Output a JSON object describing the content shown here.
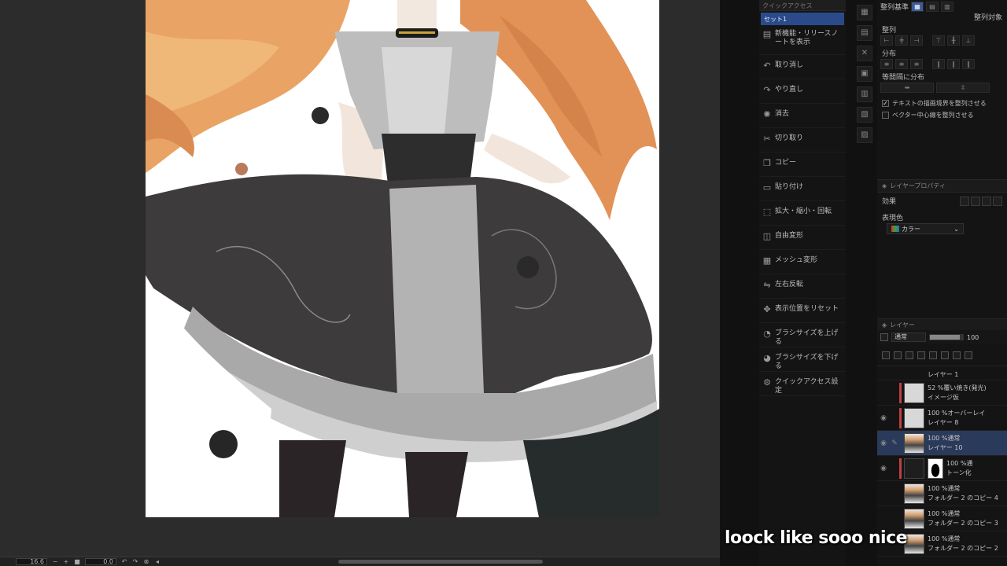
{
  "status_bar": {
    "zoom": "16.6",
    "rotation": "0.0"
  },
  "quick_menu": {
    "header": "クイックアクセス",
    "tab": "セット1",
    "items": [
      {
        "icon": "notes-icon",
        "label": "新機能・リリースノートを表示"
      },
      {
        "icon": "undo-icon",
        "label": "取り消し"
      },
      {
        "icon": "redo-icon",
        "label": "やり直し"
      },
      {
        "icon": "erase-icon",
        "label": "消去"
      },
      {
        "icon": "scissors-icon",
        "label": "切り取り"
      },
      {
        "icon": "copy-icon",
        "label": "コピー"
      },
      {
        "icon": "paste-icon",
        "label": "貼り付け"
      },
      {
        "icon": "transform-icon",
        "label": "拡大・縮小・回転"
      },
      {
        "icon": "free-transform-icon",
        "label": "自由変形"
      },
      {
        "icon": "mesh-icon",
        "label": "メッシュ変形"
      },
      {
        "icon": "flip-icon",
        "label": "左右反転"
      },
      {
        "icon": "reset-view-icon",
        "label": "表示位置をリセット"
      },
      {
        "icon": "brush-up-icon",
        "label": "ブラシサイズを上げる"
      },
      {
        "icon": "brush-down-icon",
        "label": "ブラシサイズを下げる"
      },
      {
        "icon": "settings-icon",
        "label": "クイックアクセス設定"
      }
    ]
  },
  "align_panel": {
    "reference_label": "整列基準",
    "target_label": "整列対象",
    "align_label": "整列",
    "distribute_label": "分布",
    "spacing_label": "等間隔に分布",
    "check_text_bounds": "テキストの描画境界を整列させる",
    "check_vector_center": "ベクター中心線を整列させる",
    "check_text_bounds_checked": true,
    "check_vector_center_checked": false
  },
  "layer_property": {
    "title": "レイヤープロパティ",
    "effect_label": "効果",
    "express_color_label": "表現色",
    "express_color_value": "カラー"
  },
  "layers_panel": {
    "title": "レイヤー",
    "blend_mode": "通常",
    "opacity": "100",
    "rows": [
      {
        "line1": "レイヤー 1",
        "line2": "",
        "thumb": "plain",
        "clip": false,
        "eye": false,
        "pen": false,
        "selected": false,
        "top": true
      },
      {
        "line1": "52 %覆い焼き(発光)",
        "line2": "イメージ仮",
        "thumb": "plain",
        "clip": true,
        "eye": false,
        "pen": false,
        "selected": false
      },
      {
        "line1": "100 %オーバーレイ",
        "line2": "レイヤー 8",
        "thumb": "plain",
        "clip": true,
        "eye": true,
        "pen": false,
        "selected": false
      },
      {
        "line1": "100 %通常",
        "line2": "レイヤー 10",
        "thumb": "char",
        "clip": false,
        "eye": true,
        "pen": true,
        "selected": true
      },
      {
        "line1": "100 %通",
        "line2": "トーン化",
        "thumb": "dark",
        "clip": true,
        "eye": true,
        "pen": false,
        "selected": false,
        "mask": true
      },
      {
        "line1": "100 %通常",
        "line2": "フォルダー 2 のコピー 4",
        "thumb": "char",
        "clip": false,
        "eye": false,
        "pen": false,
        "selected": false
      },
      {
        "line1": "100 %通常",
        "line2": "フォルダー 2 のコピー 3",
        "thumb": "char",
        "clip": false,
        "eye": false,
        "pen": false,
        "selected": false
      },
      {
        "line1": "100 %通常",
        "line2": "フォルダー 2 のコピー 2",
        "thumb": "char",
        "clip": false,
        "eye": false,
        "pen": false,
        "selected": false
      }
    ]
  },
  "caption": "loock like sooo nice",
  "colors": {
    "hair": "#e89a5c",
    "dress": "#3c3a3b",
    "blouse": "#b9b9b9",
    "accent": "#2a4a8a"
  }
}
